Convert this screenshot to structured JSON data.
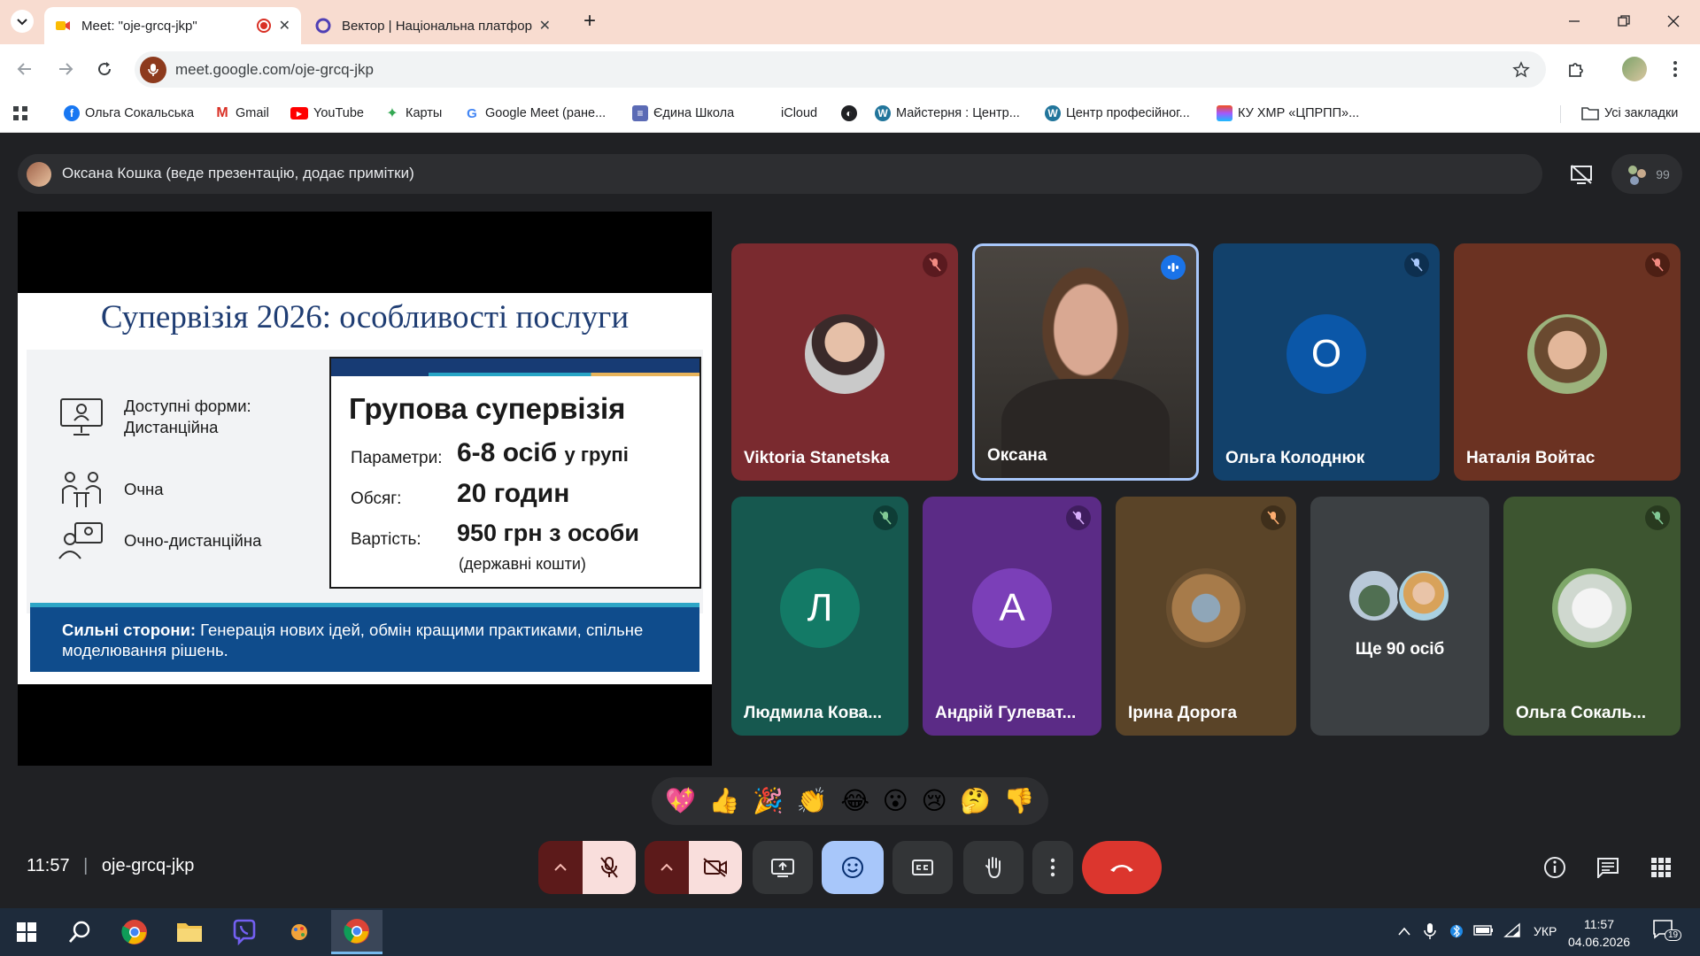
{
  "browser": {
    "tabs": [
      {
        "title": "Meet: \"oje-grcq-jkp\"",
        "active": true,
        "recording": true
      },
      {
        "title": "Вектор | Національна платфор",
        "active": false
      }
    ],
    "url": "meet.google.com/oje-grcq-jkp",
    "bookmarks": [
      {
        "label": "Ольга Сокальська",
        "icon": "facebook-icon"
      },
      {
        "label": "Gmail",
        "icon": "gmail-icon"
      },
      {
        "label": "YouTube",
        "icon": "youtube-icon"
      },
      {
        "label": "Карты",
        "icon": "maps-icon"
      },
      {
        "label": "Google Meet (ране...",
        "icon": "google-icon"
      },
      {
        "label": "Єдина Школа",
        "icon": "school-icon"
      },
      {
        "label": "iCloud",
        "icon": "apple-icon"
      },
      {
        "label": "Майстерня : Центр...",
        "icon": "wordpress-icon"
      },
      {
        "label": "Центр професійног...",
        "icon": "wordpress-icon"
      },
      {
        "label": "КУ ХМР «ЦПРПП»...",
        "icon": "figma-icon"
      }
    ],
    "all_bookmarks": "Усі закладки"
  },
  "meet": {
    "presenter_label": "Оксана Кошка (веде презентацію, додає примітки)",
    "participant_count": "99",
    "slide": {
      "title": "Супервізія 2026: особливості послуги",
      "forms": [
        {
          "label": "Доступні форми:",
          "sub": "Дистанційна"
        },
        {
          "label": "Очна"
        },
        {
          "label": "Очно-дистанційна"
        }
      ],
      "card_title": "Групова супервізія",
      "rows": [
        {
          "label": "Параметри:",
          "value": "6-8 осіб",
          "suffix": "у групі"
        },
        {
          "label": "Обсяг:",
          "value": "20 годин"
        },
        {
          "label": "Вартість:",
          "value": "950 грн з особи"
        }
      ],
      "note": "(державні кошти)",
      "strength_label": "Сильні сторони:",
      "strength_text": " Генерація нових ідей, обмін кращими практиками, спільне моделювання рішень."
    },
    "participants": [
      {
        "name": "Viktoria Stanetska",
        "muted": true,
        "color": "#7a2a2f"
      },
      {
        "name": "Оксана",
        "muted": false,
        "speaking": true,
        "color": "#3c3b39"
      },
      {
        "name": "Ольга Колоднюк",
        "muted": true,
        "initial": "О",
        "color": "#12416b"
      },
      {
        "name": "Наталія Войтас",
        "muted": true,
        "color": "#6b3222"
      },
      {
        "name": "Людмила Кова...",
        "muted": true,
        "initial": "Л",
        "color": "#16584f"
      },
      {
        "name": "Андрій Гулеват...",
        "muted": true,
        "initial": "А",
        "color": "#5b2b86"
      },
      {
        "name": "Ірина Дорога",
        "muted": true,
        "color": "#5a4428"
      },
      {
        "name": "Ще 90 осіб",
        "muted": false,
        "color": "#3c4043"
      },
      {
        "name": "Ольга Сокаль...",
        "muted": true,
        "color": "#3d5530"
      }
    ],
    "reactions": [
      "💖",
      "👍",
      "🎉",
      "👏",
      "😂",
      "😮",
      "😢",
      "🤔",
      "👎"
    ],
    "time": "11:57",
    "meeting_code": "oje-grcq-jkp"
  },
  "taskbar": {
    "language": "УКР",
    "time": "11:57",
    "date": "04.06.2026",
    "notifications": "19"
  }
}
